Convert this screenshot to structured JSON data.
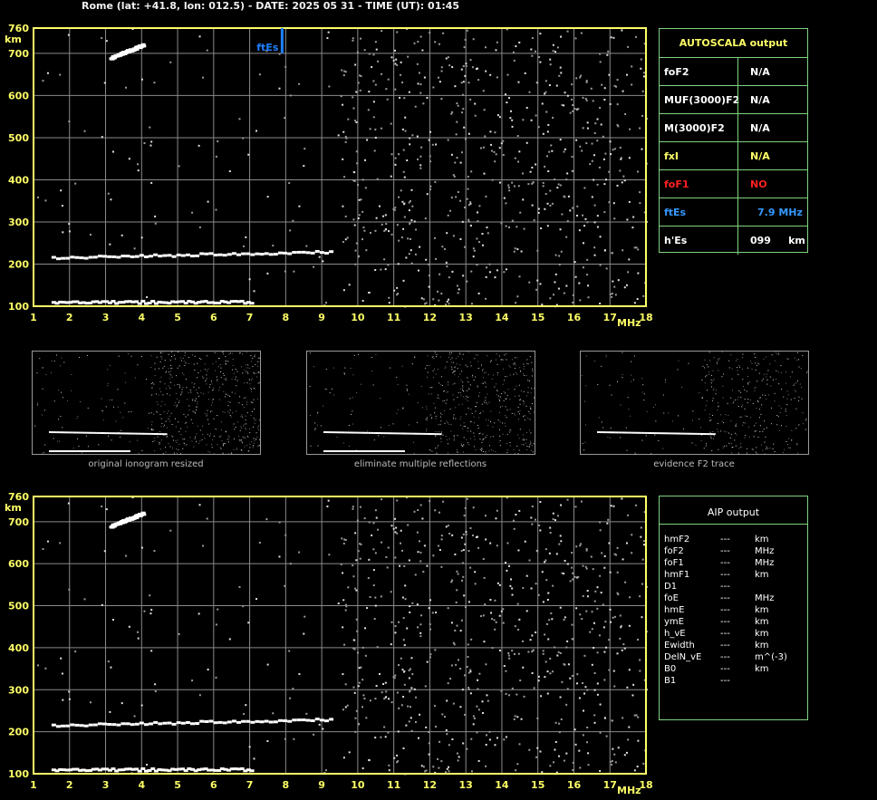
{
  "header": {
    "title": "Rome (lat: +41.8, lon: 012.5) - DATE: 2025 05 31 - TIME (UT): 01:45"
  },
  "colors": {
    "grid": "#8a8a8a",
    "frame": "#ffff66",
    "text_axis": "#ffff66",
    "panel_border": "#7fd27f",
    "ftEs": "#1e7fff",
    "foF1": "#ff2020"
  },
  "chart_data": [
    {
      "type": "scatter",
      "title": "",
      "xlabel": "MHz",
      "ylabel": "km",
      "xlim": [
        1,
        18
      ],
      "ylim": [
        100,
        760
      ],
      "x_ticks": [
        "1",
        "2",
        "3",
        "4",
        "5",
        "6",
        "7",
        "8",
        "9",
        "10",
        "11",
        "12",
        "13",
        "14",
        "15",
        "16",
        "17",
        "18"
      ],
      "y_ticks": [
        "100",
        "200",
        "300",
        "400",
        "500",
        "600",
        "700",
        "760"
      ],
      "traces": [
        {
          "name": "E trace",
          "x": [
            1.5,
            7.0
          ],
          "y": [
            110,
            110
          ]
        },
        {
          "name": "Es trace",
          "x": [
            1.5,
            9.2
          ],
          "y": [
            215,
            230
          ]
        },
        {
          "name": "upper echo",
          "x": [
            3.1,
            4.0
          ],
          "y": [
            690,
            720
          ]
        }
      ],
      "annotation": {
        "label": "ftEs",
        "x": 7.9,
        "y_from": 700,
        "y_to": 760
      }
    },
    {
      "type": "scatter",
      "title": "",
      "xlabel": "MHz",
      "ylabel": "km",
      "xlim": [
        1,
        18
      ],
      "ylim": [
        100,
        760
      ],
      "x_ticks": [
        "1",
        "2",
        "3",
        "4",
        "5",
        "6",
        "7",
        "8",
        "9",
        "10",
        "11",
        "12",
        "13",
        "14",
        "15",
        "16",
        "17",
        "18"
      ],
      "y_ticks": [
        "100",
        "200",
        "300",
        "400",
        "500",
        "600",
        "700",
        "760"
      ],
      "traces": [
        {
          "name": "E trace",
          "x": [
            1.5,
            7.0
          ],
          "y": [
            110,
            110
          ]
        },
        {
          "name": "Es trace",
          "x": [
            1.5,
            9.2
          ],
          "y": [
            215,
            230
          ]
        },
        {
          "name": "upper echo",
          "x": [
            3.1,
            4.0
          ],
          "y": [
            690,
            720
          ]
        }
      ]
    }
  ],
  "autoscala": {
    "title": "AUTOSCALA output",
    "rows": [
      {
        "key": "foF2",
        "value": "N/A",
        "color": "#ffffff"
      },
      {
        "key": "MUF(3000)F2",
        "value": "N/A",
        "color": "#ffffff"
      },
      {
        "key": "M(3000)F2",
        "value": "N/A",
        "color": "#ffffff"
      },
      {
        "key": "fxI",
        "value": "N/A",
        "color": "#ffff66"
      },
      {
        "key": "foF1",
        "value": "NO",
        "color": "#ff2020"
      },
      {
        "key": "ftEs",
        "value": "7.9 MHz",
        "color": "#3399ff"
      },
      {
        "key": "h'Es",
        "value": "099     km",
        "color": "#ffffff"
      }
    ]
  },
  "thumbnails": [
    {
      "caption": "original ionogram resized"
    },
    {
      "caption": "eliminate multiple reflections"
    },
    {
      "caption": "evidence F2 trace"
    }
  ],
  "aip": {
    "title": "AIP output",
    "rows": [
      {
        "k": "hmF2",
        "v": "---",
        "u": "km"
      },
      {
        "k": "foF2",
        "v": "---",
        "u": "MHz"
      },
      {
        "k": "foF1",
        "v": "---",
        "u": "MHz"
      },
      {
        "k": "hmF1",
        "v": "---",
        "u": "km"
      },
      {
        "k": "D1",
        "v": "---",
        "u": ""
      },
      {
        "k": "foE",
        "v": "---",
        "u": "MHz"
      },
      {
        "k": "hmE",
        "v": "---",
        "u": "km"
      },
      {
        "k": "ymE",
        "v": "---",
        "u": "km"
      },
      {
        "k": "h_vE",
        "v": "---",
        "u": "km"
      },
      {
        "k": "Ewidth",
        "v": "---",
        "u": "km"
      },
      {
        "k": "DelN_vE",
        "v": "---",
        "u": "m^(-3)"
      },
      {
        "k": "B0",
        "v": "---",
        "u": "km"
      },
      {
        "k": "B1",
        "v": "---",
        "u": ""
      }
    ]
  }
}
